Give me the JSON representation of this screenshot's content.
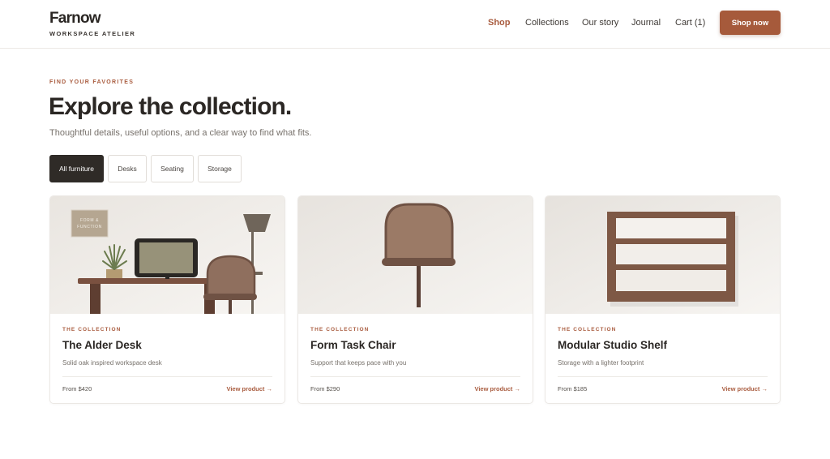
{
  "brand": {
    "name": "Farnow",
    "tagline": "WORKSPACE ATELIER"
  },
  "nav": {
    "items": [
      {
        "label": "Shop",
        "active": true
      },
      {
        "label": "Collections",
        "active": false
      },
      {
        "label": "Our story",
        "active": false
      },
      {
        "label": "Journal",
        "active": false
      },
      {
        "label": "Cart (1)",
        "active": false
      }
    ],
    "cta_label": "Shop now"
  },
  "hero": {
    "eyebrow": "FIND YOUR FAVORITES",
    "title": "Explore the collection.",
    "subtitle": "Thoughtful details, useful options, and a clear way to find what fits."
  },
  "filters": [
    {
      "label": "All furniture",
      "active": true
    },
    {
      "label": "Desks",
      "active": false
    },
    {
      "label": "Seating",
      "active": false
    },
    {
      "label": "Storage",
      "active": false
    }
  ],
  "products": [
    {
      "eyebrow": "THE COLLECTION",
      "title": "The Alder Desk",
      "description": "Solid oak inspired workspace desk",
      "price": "From $420",
      "link": "View product →",
      "image_label": "FORM & FUNCTION",
      "icon": "desk-scene-illustration"
    },
    {
      "eyebrow": "THE COLLECTION",
      "title": "Form Task Chair",
      "description": "Support that keeps pace with you",
      "price": "From $290",
      "link": "View product →",
      "icon": "chair-illustration"
    },
    {
      "eyebrow": "THE COLLECTION",
      "title": "Modular Studio Shelf",
      "description": "Storage with a lighter footprint",
      "price": "From $185",
      "link": "View product →",
      "icon": "shelf-illustration"
    }
  ],
  "colors": {
    "accent": "#a95c3f",
    "button": "#a65a3b",
    "ink": "#2b2724",
    "wood": "#7a5140",
    "chair": "#8f6f5e"
  }
}
